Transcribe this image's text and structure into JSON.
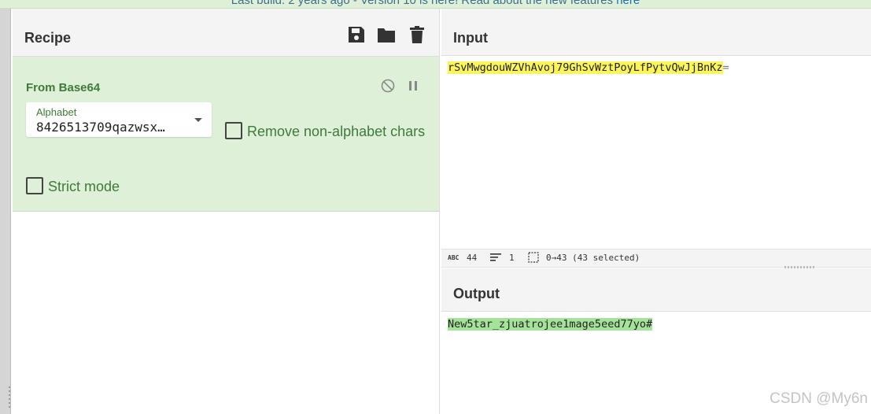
{
  "banner": {
    "text": "Last build: 2 years ago - Version 10 is here! Read about the new features ",
    "link": "here"
  },
  "recipe": {
    "title": "Recipe",
    "icons": [
      "save-icon",
      "folder-icon",
      "trash-icon"
    ],
    "operation": {
      "title": "From Base64",
      "alphabet_label": "Alphabet",
      "alphabet_value": "8426513709qazwsx…",
      "remove_label": "Remove non-alphabet chars",
      "strict_label": "Strict mode"
    }
  },
  "input": {
    "title": "Input",
    "text_highlighted": "rSvMwgdouWZVhAvoj79GhSvWztPoyLfPytvQwJjBnKz",
    "text_rest": "=",
    "status": {
      "chars": "44",
      "lines": "1",
      "selection": "0→43 (43 selected)"
    }
  },
  "output": {
    "title": "Output",
    "text": "New5tar_zjuatrojee1mage5eed77yo#"
  },
  "watermark": "CSDN @My6n",
  "colors": {
    "banner_bg": "#dff0d8",
    "op_bg": "#dff0d8",
    "op_text": "#3e7a3a",
    "highlight_input": "#fbf45a",
    "highlight_output": "#a6e39a"
  }
}
